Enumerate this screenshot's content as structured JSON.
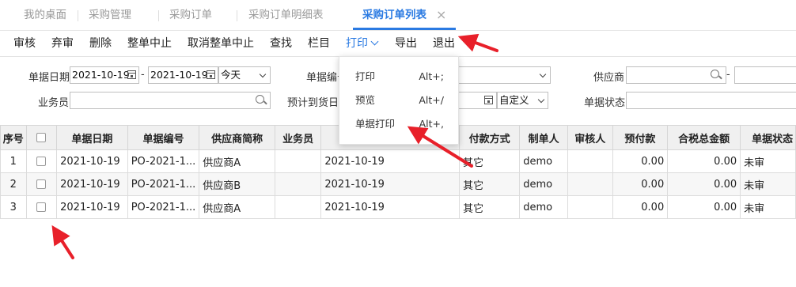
{
  "tabs": [
    {
      "label": "我的桌面",
      "active": false
    },
    {
      "label": "采购管理",
      "active": false
    },
    {
      "label": "采购订单",
      "active": false
    },
    {
      "label": "采购订单明细表",
      "active": false
    },
    {
      "label": "采购订单列表",
      "active": true
    }
  ],
  "tab_close": "×",
  "toolbar": {
    "audit": "审核",
    "unaudit": "弃审",
    "delete": "删除",
    "close_all": "整单中止",
    "cancel_close": "取消整单中止",
    "find": "查找",
    "columns": "栏目",
    "print": "打印",
    "export": "导出",
    "exit": "退出"
  },
  "print_menu": [
    {
      "label": "打印",
      "shortcut": "Alt+;"
    },
    {
      "label": "预览",
      "shortcut": "Alt+/"
    },
    {
      "label": "单据打印",
      "shortcut": "Alt+,"
    }
  ],
  "filters": {
    "doc_date_label": "单据日期",
    "date_from": "2021-10-19",
    "date_to": "2021-10-19",
    "date_range": "今天",
    "dash": "-",
    "doc_no_label": "单据编号",
    "supplier_label": "供应商",
    "salesman_label": "业务员",
    "arrival_label": "预计到货日期",
    "arrival_range": "自定义",
    "doc_status_label": "单据状态"
  },
  "table": {
    "headers": [
      "序号",
      "",
      "单据日期",
      "单据编号",
      "供应商简称",
      "业务员",
      "",
      "付款方式",
      "制单人",
      "审核人",
      "预付款",
      "合税总金额",
      "单据状态"
    ],
    "rows": [
      {
        "no": "1",
        "date": "2021-10-19",
        "code": "PO-2021-1...",
        "supplier": "供应商A",
        "salesman": "",
        "arrival": "2021-10-19",
        "pay": "其它",
        "maker": "demo",
        "auditor": "",
        "prepay": "0.00",
        "total": "0.00",
        "status": "未审"
      },
      {
        "no": "2",
        "date": "2021-10-19",
        "code": "PO-2021-1...",
        "supplier": "供应商B",
        "salesman": "",
        "arrival": "2021-10-19",
        "pay": "其它",
        "maker": "demo",
        "auditor": "",
        "prepay": "0.00",
        "total": "0.00",
        "status": "未审"
      },
      {
        "no": "3",
        "date": "2021-10-19",
        "code": "PO-2021-1...",
        "supplier": "供应商A",
        "salesman": "",
        "arrival": "2021-10-19",
        "pay": "其它",
        "maker": "demo",
        "auditor": "",
        "prepay": "0.00",
        "total": "0.00",
        "status": "未审"
      }
    ]
  },
  "colors": {
    "accent": "#2a7ae2",
    "annotation_arrow": "#e8202a"
  }
}
